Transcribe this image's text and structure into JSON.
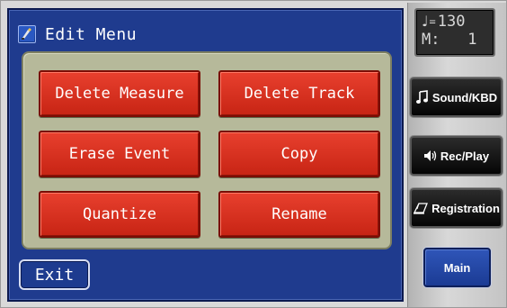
{
  "title_bar": {
    "icon": "edit-menu-icon",
    "title": "Edit Menu"
  },
  "edit_buttons": [
    {
      "label": "Delete Measure"
    },
    {
      "label": "Delete Track"
    },
    {
      "label": "Erase Event"
    },
    {
      "label": "Copy"
    },
    {
      "label": "Quantize"
    },
    {
      "label": "Rename"
    }
  ],
  "exit_label": "Exit",
  "display": {
    "tempo_prefix": "=",
    "tempo": "130",
    "measure_label": "M:",
    "measure": "1"
  },
  "sidebar": {
    "sound_kbd": {
      "label": "Sound/KBD",
      "icon": "music-note-icon"
    },
    "rec_play": {
      "label": "Rec/Play",
      "icon": "speaker-icon"
    },
    "registration": {
      "label": "Registration",
      "icon": "music-stand-icon"
    },
    "main": {
      "label": "Main"
    }
  },
  "colors": {
    "panel_blue": "#1f3b8e",
    "content_bg": "#b6b99a",
    "button_red": "#d7301f",
    "sidebar_grey": "#cfcfcf"
  }
}
